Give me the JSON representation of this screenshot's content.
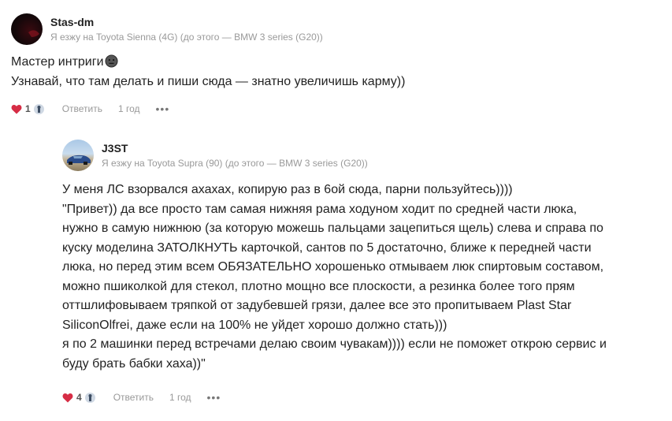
{
  "comments": [
    {
      "username": "Stas-dm",
      "car_line": "Я езжу на Toyota Sienna (4G) (до этого — BMW 3 series (G20))",
      "lines": [
        "Мастер интриги",
        "Узнавай, что там делать и пиши сюда — знатно увеличишь карму))"
      ],
      "likes": "1",
      "reply_label": "Ответить",
      "time": "1 год",
      "more": "•••"
    },
    {
      "username": "J3ST",
      "car_line": "Я езжу на Toyota Supra (90) (до этого — BMW 3 series (G20))",
      "lines": [
        "У меня ЛС взорвался ахахах, копирую раз в 6ой сюда, парни пользуйтесь))))",
        "\"Привет)) да все просто там самая нижняя рама ходуном ходит по средней части люка,",
        "нужно в самую нижнюю (за которую можешь пальцами зацепиться щель) слева и справа по",
        "куску моделина ЗАТОЛКНУТЬ карточкой, сантов по 5 достаточно, ближе к передней части",
        "люка, но перед этим всем ОБЯЗАТЕЛЬНО хорошенько отмываем люк спиртовым составом,",
        "можно пшиколкой для стекол, плотно мощно все плоскости, а резинка более того прям",
        "оттшлифовываем тряпкой от задубевшей грязи, далее все это пропитываем Plast Star",
        "SiliconOlfrei, даже если на 100% не уйдет хорошо должно стать)))",
        "я по 2 машинки перед встречами делаю своим чувакам)))) если не поможет открою сервис и",
        "буду брать бабки хаха))\""
      ],
      "likes": "4",
      "reply_label": "Ответить",
      "time": "1 год",
      "more": "•••"
    }
  ],
  "colors": {
    "heart": "#d62d45",
    "meta": "#999999",
    "text": "#222222"
  },
  "icons": {
    "like": "heart-icon",
    "emoji": "neutral-face-emoji-icon",
    "more": "more-dots-icon"
  }
}
